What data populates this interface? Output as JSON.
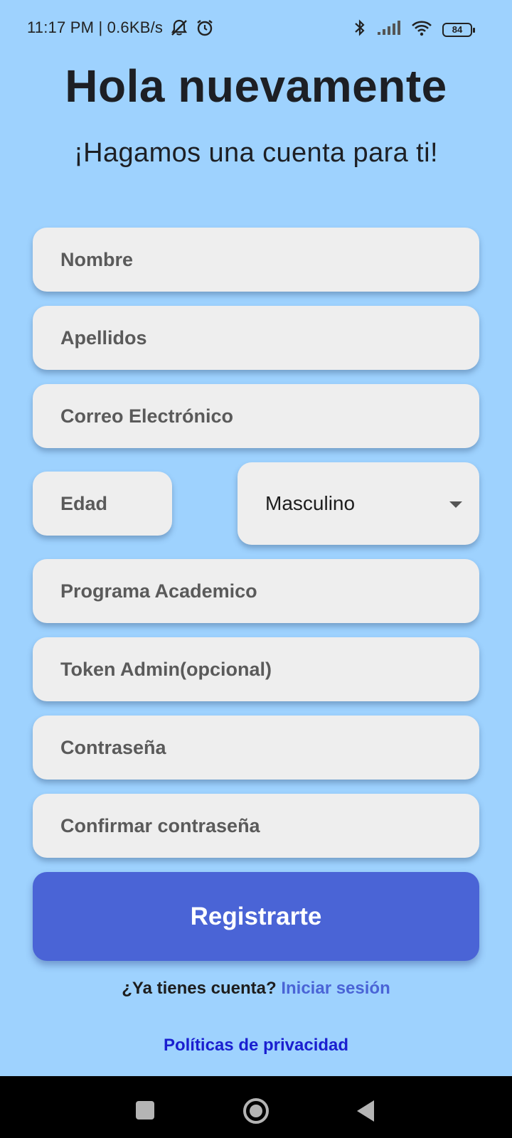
{
  "status_bar": {
    "time_speed": "11:17 PM | 0.6KB/s",
    "battery": "84",
    "icons": [
      "mute-icon",
      "alarm-icon",
      "bluetooth-icon",
      "signal-icon",
      "wifi-icon",
      "battery-icon"
    ]
  },
  "header": {
    "title": "Hola nuevamente",
    "subtitle": "¡Hagamos una cuenta para ti!"
  },
  "form": {
    "name_placeholder": "Nombre",
    "lastname_placeholder": "Apellidos",
    "email_placeholder": "Correo Electrónico",
    "age_placeholder": "Edad",
    "gender_selected": "Masculino",
    "program_placeholder": "Programa Academico",
    "token_placeholder": "Token Admin(opcional)",
    "password_placeholder": "Contraseña",
    "confirm_password_placeholder": "Confirmar contraseña",
    "register_label": "Registrarte"
  },
  "footer": {
    "have_account": "¿Ya tienes cuenta?",
    "login_link": "Iniciar sesión",
    "privacy_link": "Políticas de privacidad"
  },
  "colors": {
    "background": "#9ed2fe",
    "field": "#eeeeee",
    "button": "#4a64d6",
    "privacy_link": "#1a1fd0"
  }
}
